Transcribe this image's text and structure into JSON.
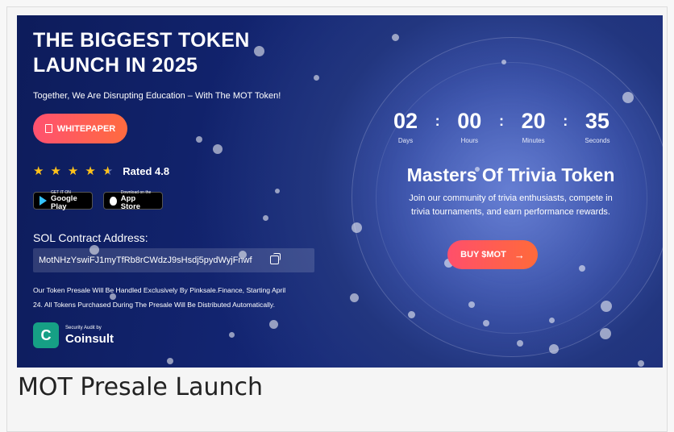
{
  "hero": {
    "headline_line1": "THE BIGGEST TOKEN",
    "headline_line2": "LAUNCH IN 2025",
    "tagline": "Together, We Are Disrupting Education – With The MOT Token!",
    "whitepaper_label": "WHITEPAPER",
    "rating_stars": 4.8,
    "rating_text": "Rated 4.8",
    "google_play": {
      "small": "GET IT ON",
      "big": "Google Play"
    },
    "app_store": {
      "small": "Download on the",
      "big": "App Store"
    },
    "contract_label": "SOL Contract Address:",
    "contract_address": "MotNHzYswiFJ1myTfRb8rCWdzJ9sHsdj5pydWyjFnwf",
    "notice_line1": "Our Token Presale Will Be Handled Exclusively By Pinksale.Finance, Starting April",
    "notice_line2": "24. All Tokens Purchased During The Presale Will Be Distributed Automatically.",
    "audit_small": "Security Audit by",
    "audit_big": "Coinsult"
  },
  "countdown": [
    {
      "value": "02",
      "label": "Days"
    },
    {
      "value": "00",
      "label": "Hours"
    },
    {
      "value": "20",
      "label": "Minutes"
    },
    {
      "value": "35",
      "label": "Seconds"
    }
  ],
  "token": {
    "title": "Masters Of Trivia Token",
    "desc_line1": "Join our community of trivia enthusiasts, compete in",
    "desc_line2": "trivia tournaments, and earn performance rewards.",
    "buy_label": "BUY $MOT"
  },
  "caption": "MOT Presale Launch",
  "colors": {
    "brand_gradient_start": "#ff5170",
    "brand_gradient_end": "#ff6b3f",
    "banner_bg": "#15287a",
    "star": "#ffc21a",
    "audit_green": "#16a085"
  }
}
